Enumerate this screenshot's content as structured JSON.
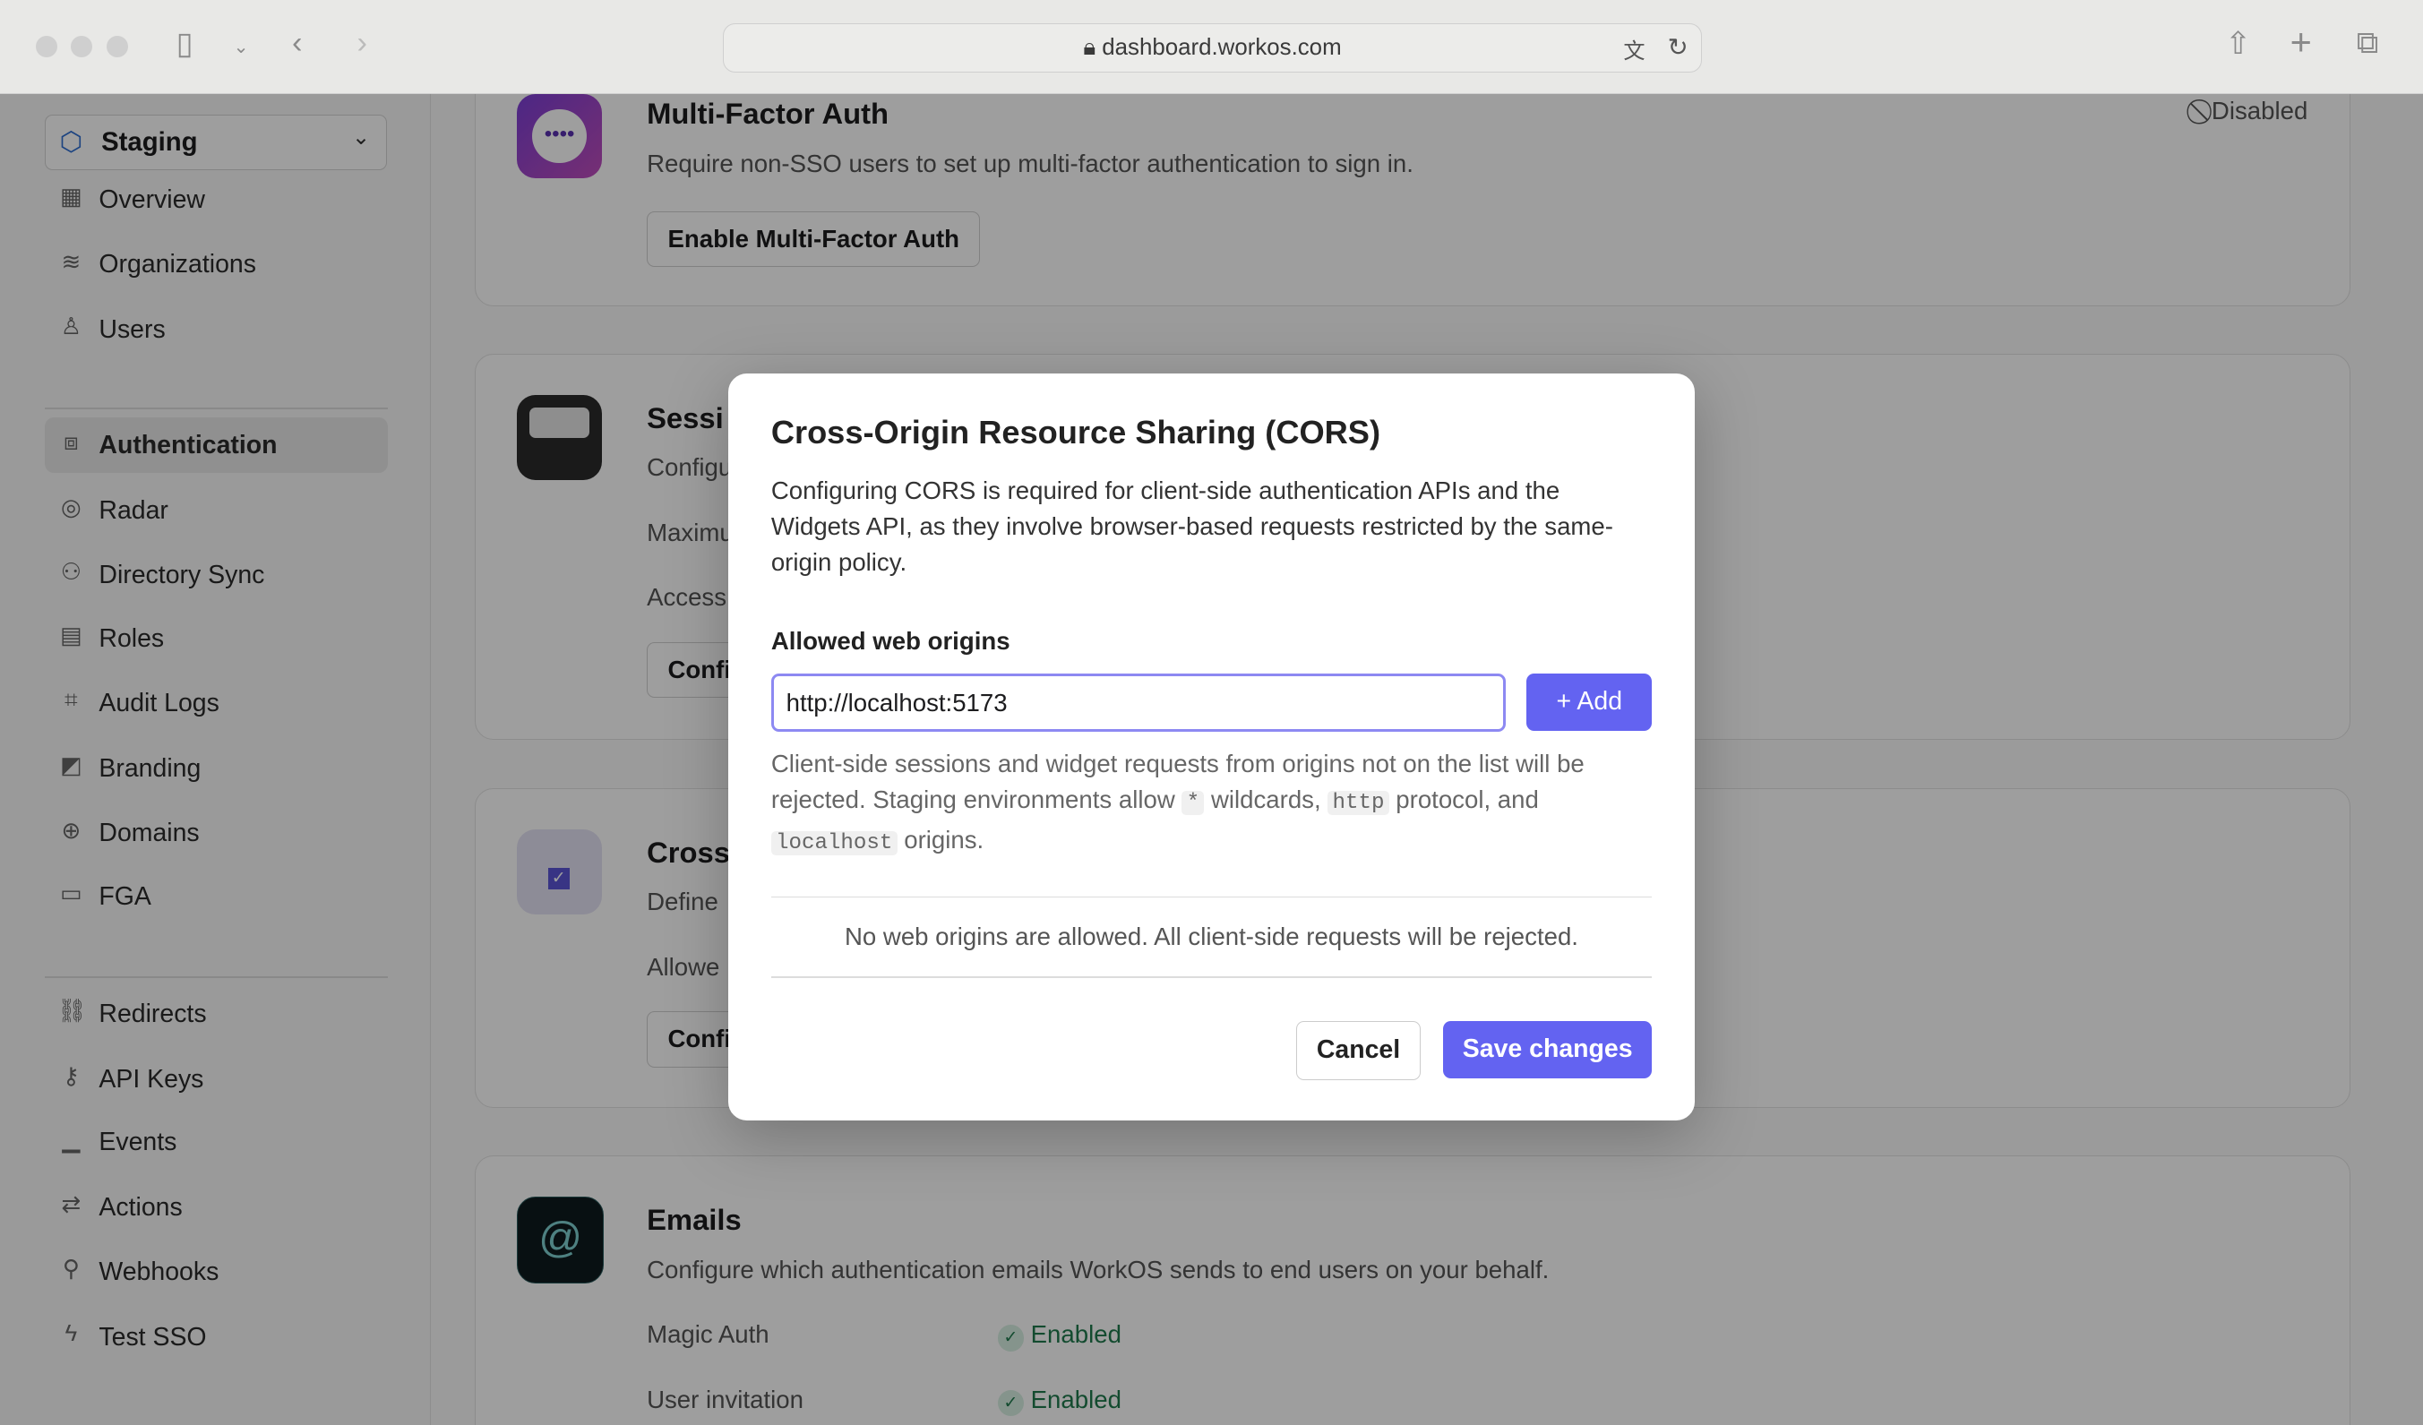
{
  "browser": {
    "url": "dashboard.workos.com"
  },
  "sidebar": {
    "environment": "Staging",
    "items": [
      {
        "label": "Overview",
        "icon": "grid-icon"
      },
      {
        "label": "Organizations",
        "icon": "layers-icon"
      },
      {
        "label": "Users",
        "icon": "user-icon"
      },
      {
        "label": "Authentication",
        "icon": "auth-icon",
        "active": true
      },
      {
        "label": "Radar",
        "icon": "radar-icon"
      },
      {
        "label": "Directory Sync",
        "icon": "users-icon"
      },
      {
        "label": "Roles",
        "icon": "id-card-icon"
      },
      {
        "label": "Audit Logs",
        "icon": "scan-icon"
      },
      {
        "label": "Branding",
        "icon": "swatch-icon"
      },
      {
        "label": "Domains",
        "icon": "globe-icon"
      },
      {
        "label": "FGA",
        "icon": "ticket-icon"
      },
      {
        "label": "Redirects",
        "icon": "link-icon"
      },
      {
        "label": "API Keys",
        "icon": "key-icon"
      },
      {
        "label": "Events",
        "icon": "bars-icon"
      },
      {
        "label": "Actions",
        "icon": "actions-icon"
      },
      {
        "label": "Webhooks",
        "icon": "webhook-icon"
      },
      {
        "label": "Test SSO",
        "icon": "bolt-icon"
      }
    ]
  },
  "main": {
    "mfa": {
      "title": "Multi-Factor Auth",
      "description": "Require non-SSO users to set up multi-factor authentication to sign in.",
      "button": "Enable Multi-Factor Auth",
      "status": "Disabled"
    },
    "sessions": {
      "title": "Sessi",
      "line1": "Configu",
      "line2": "Maximu",
      "line3": "Access",
      "button": "Confi"
    },
    "cors": {
      "title": "Cross",
      "line1": "Define",
      "line2": "Allowe",
      "button": "Confi"
    },
    "emails": {
      "title": "Emails",
      "description": "Configure which authentication emails WorkOS sends to end users on your behalf.",
      "rows": [
        {
          "label": "Magic Auth",
          "status": "Enabled"
        },
        {
          "label": "User invitation",
          "status": "Enabled"
        }
      ]
    }
  },
  "modal": {
    "title": "Cross-Origin Resource Sharing (CORS)",
    "description": "Configuring CORS is required for client-side authentication APIs and the Widgets API, as they involve browser-based requests restricted by the same-origin policy.",
    "field_label": "Allowed web origins",
    "input_value": "http://localhost:5173",
    "add_label": "Add",
    "help": {
      "p1": "Client-side sessions and widget requests from origins not on the list will be rejected. Staging environments allow",
      "code1": "*",
      "p2": "wildcards,",
      "code2": "http",
      "p3": "protocol, and",
      "code3": "localhost",
      "p4": "origins."
    },
    "empty": "No web origins are allowed. All client-side requests will be rejected.",
    "cancel": "Cancel",
    "save": "Save changes"
  },
  "colors": {
    "accent": "#6363f1",
    "enabled": "#1f7a4d"
  }
}
